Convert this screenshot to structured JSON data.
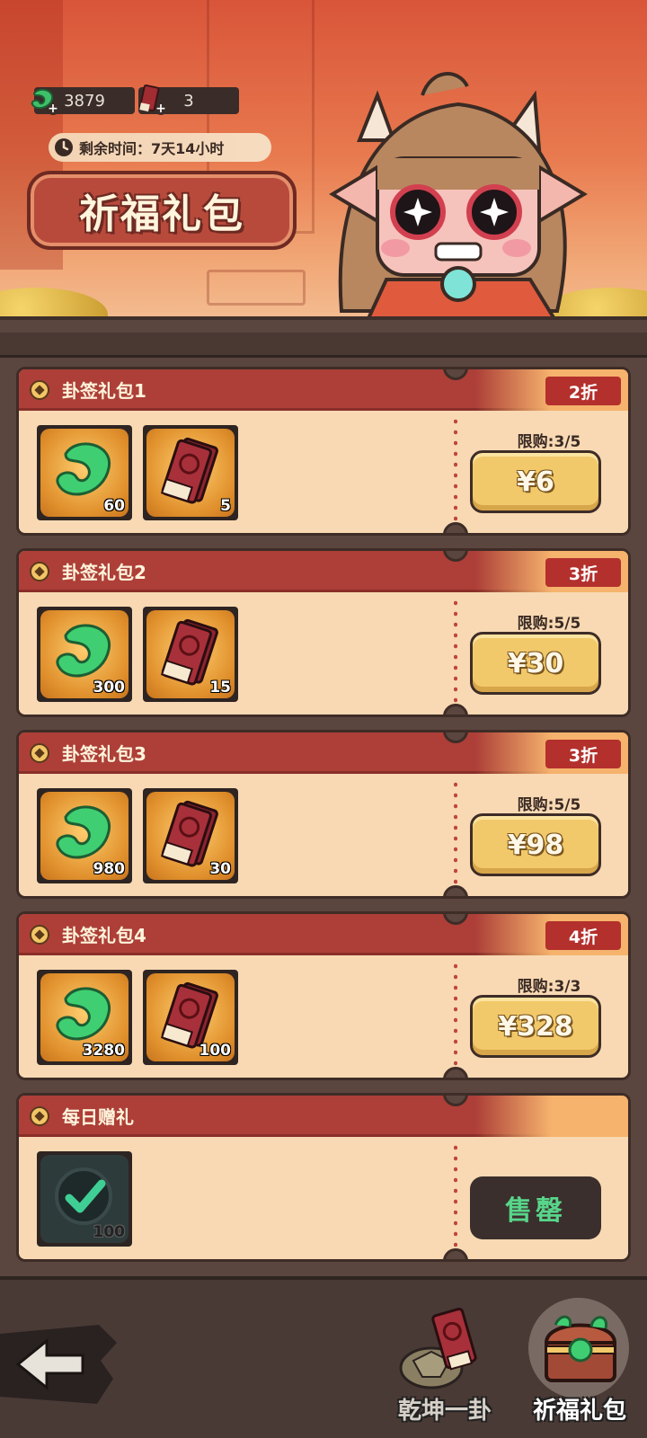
{
  "header": {
    "currencies": [
      {
        "icon": "jade-icon",
        "value": "3879"
      },
      {
        "icon": "ticket-icon",
        "value": "3"
      }
    ],
    "timer_label": "剩余时间：7天14小时",
    "title": "祈福礼包"
  },
  "packs": [
    {
      "name": "卦签礼包1",
      "discount": "2折",
      "items": [
        {
          "icon": "jade-icon",
          "qty": "60"
        },
        {
          "icon": "ticket-icon",
          "qty": "5"
        }
      ],
      "limit": "限购:3/5",
      "price": "¥6"
    },
    {
      "name": "卦签礼包2",
      "discount": "3折",
      "items": [
        {
          "icon": "jade-icon",
          "qty": "300"
        },
        {
          "icon": "ticket-icon",
          "qty": "15"
        }
      ],
      "limit": "限购:5/5",
      "price": "¥30"
    },
    {
      "name": "卦签礼包3",
      "discount": "3折",
      "items": [
        {
          "icon": "jade-icon",
          "qty": "980"
        },
        {
          "icon": "ticket-icon",
          "qty": "30"
        }
      ],
      "limit": "限购:5/5",
      "price": "¥98"
    },
    {
      "name": "卦签礼包4",
      "discount": "4折",
      "items": [
        {
          "icon": "jade-icon",
          "qty": "3280"
        },
        {
          "icon": "ticket-icon",
          "qty": "100"
        }
      ],
      "limit": "限购:3/3",
      "price": "¥328"
    },
    {
      "name": "每日赠礼",
      "items": [
        {
          "icon": "check-icon",
          "qty": "100"
        }
      ],
      "button": "售罄"
    }
  ],
  "nav": {
    "tabs": [
      {
        "label": "乾坤一卦",
        "icon": "turtle-shell-icon"
      },
      {
        "label": "祈福礼包",
        "icon": "treasure-chest-icon"
      }
    ]
  },
  "colors": {
    "card_bg": "#f8d9b3",
    "card_header": "#ad3f38",
    "price_button": "#f2c96a",
    "soldout_text": "#58d58a"
  }
}
